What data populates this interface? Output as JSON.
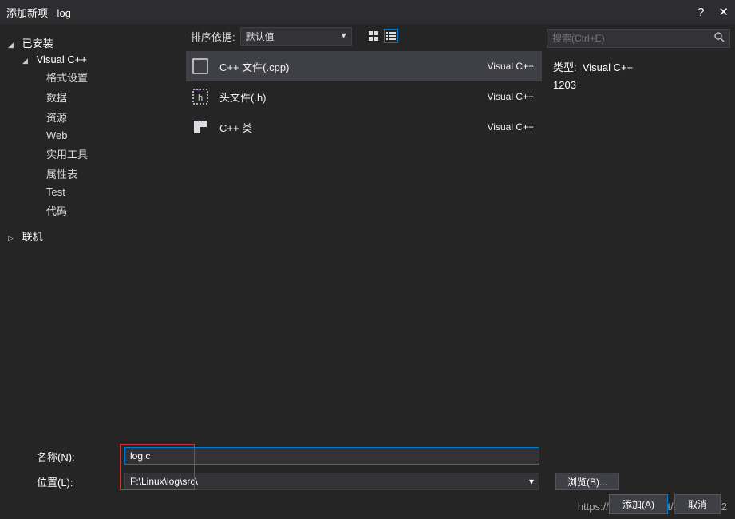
{
  "window": {
    "title": "添加新项 - log",
    "help": "?",
    "close": "✕"
  },
  "sidebar": {
    "root": {
      "label": "已安装"
    },
    "category": {
      "label": "Visual C++"
    },
    "items": [
      {
        "label": "格式设置"
      },
      {
        "label": "数据"
      },
      {
        "label": "资源"
      },
      {
        "label": "Web"
      },
      {
        "label": "实用工具"
      },
      {
        "label": "属性表"
      },
      {
        "label": "Test"
      },
      {
        "label": "代码"
      }
    ],
    "online": {
      "label": "联机"
    }
  },
  "sort": {
    "label": "排序依据:",
    "value": "默认值",
    "caret": "▾"
  },
  "templates": [
    {
      "name": "C++ 文件(.cpp)",
      "lang": "Visual C++",
      "icon": "cpp",
      "selected": true
    },
    {
      "name": "头文件(.h)",
      "lang": "Visual C++",
      "icon": "h",
      "selected": false
    },
    {
      "name": "C++ 类",
      "lang": "Visual C++",
      "icon": "class",
      "selected": false
    }
  ],
  "search": {
    "placeholder": "搜索(Ctrl+E)"
  },
  "description": {
    "type_label": "类型:",
    "type_value": "Visual C++",
    "extra": "1203"
  },
  "form": {
    "name_label": "名称(N):",
    "name_value": "log.c",
    "location_label": "位置(L):",
    "location_value": "F:\\Linux\\log\\src\\",
    "browse_label": "浏览(B)..."
  },
  "footer": {
    "add": "添加(A)",
    "cancel": "取消"
  },
  "watermark": "https://blog.csdn.net/ZX7149442"
}
